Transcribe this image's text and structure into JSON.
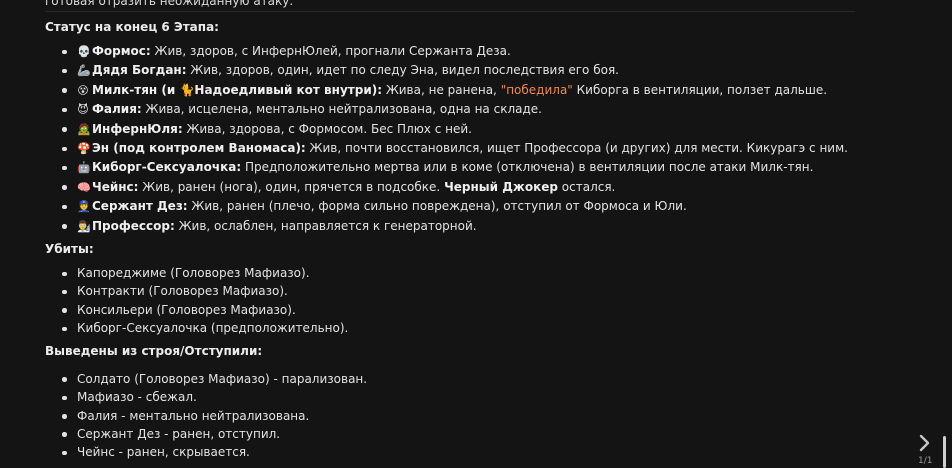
{
  "top_text": "готовая отразить неожиданную атаку.",
  "status": {
    "heading": "Статус на конец 6 Этапа:",
    "items": [
      {
        "emoji": "💀",
        "name": "Формос:",
        "text": " Жив, здоров, с ИнфернЮлей, прогнали Сержанта Деза."
      },
      {
        "emoji": "🦾",
        "name": "Дядя Богдан:",
        "text": " Жив, здоров, один, идет по следу Эна, видел последствия его боя."
      },
      {
        "emoji": "😵",
        "name": "Милк-тян (и 🐈Надоедливый кот внутри):",
        "text_before": " Жива, не ранена, ",
        "accent": "\"победила\"",
        "text_after": " Киборга в вентиляции, ползет дальше."
      },
      {
        "emoji": "😈",
        "name": "Фалия:",
        "text": " Жива, исцелена, ментально нейтрализована, одна на складе."
      },
      {
        "emoji": "🧟",
        "name": "ИнфернЮля:",
        "text": " Жива, здорова, с Формосом. Бес Плюх с ней."
      },
      {
        "emoji": "🍄",
        "name": "Эн (под контролем Ваномаса):",
        "text": " Жив, почти восстановился, ищет Профессора (и других) для мести. Кикурагэ с ним."
      },
      {
        "emoji": "🤖",
        "name": "Киборг-Сексуалочка:",
        "text": " Предположительно мертва или в коме (отключена) в вентиляции после атаки Милк-тян."
      },
      {
        "emoji": "🧠",
        "name": "Чейнс:",
        "text_before": " Жив, ранен (нога), один, прячется в подсобке. ",
        "bold_tail": "Черный Джокер",
        "text_after": " остался."
      },
      {
        "emoji": "👮",
        "name": "Сержант Дез:",
        "text": " Жив, ранен (плечо, форма сильно повреждена), отступил от Формоса и Юли."
      },
      {
        "emoji": "👨‍🔬",
        "name": "Профессор:",
        "text": " Жив, ослаблен, направляется к генераторной."
      }
    ]
  },
  "killed": {
    "heading": "Убиты:",
    "items": [
      "Капореджиме (Головорез Мафиазо).",
      "Контракти (Головорез Мафиазо).",
      "Консильери (Головорез Мафиазо).",
      "Киборг-Сексуалочка (предположительно)."
    ]
  },
  "out": {
    "heading": "Выведены из строя/Отступили:",
    "items": [
      "Солдато (Головорез Мафиазо) - парализован.",
      "Мафиазо - сбежал.",
      "Фалия - ментально нейтрализована.",
      "Сержант Дез - ранен, отступил.",
      "Чейнс - ранен, скрывается."
    ]
  },
  "pager": {
    "indicator": "1/1",
    "next_icon": "chevron-right-icon"
  },
  "colors": {
    "background": "#141414",
    "text": "#e3e3e3",
    "accent": "#f08a4b"
  }
}
